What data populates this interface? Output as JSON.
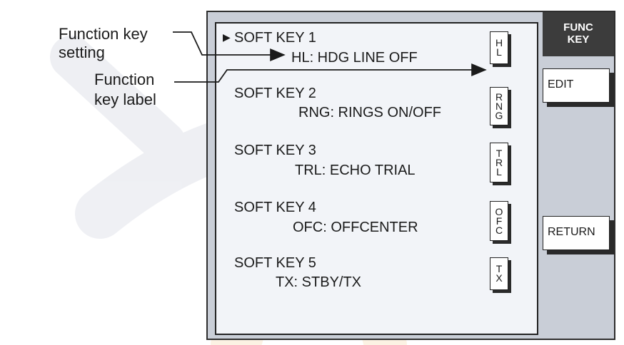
{
  "panel": {
    "title": "FUNC KEY"
  },
  "soft_keys": [
    {
      "title": "SOFT KEY 1",
      "setting": "HL: HDG LINE OFF",
      "label_chars": [
        "H",
        "L"
      ]
    },
    {
      "title": "SOFT KEY 2",
      "setting": "RNG: RINGS ON/OFF",
      "label_chars": [
        "R",
        "N",
        "G"
      ]
    },
    {
      "title": "SOFT KEY 3",
      "setting": "TRL: ECHO TRIAL",
      "label_chars": [
        "T",
        "R",
        "L"
      ]
    },
    {
      "title": "SOFT KEY 4",
      "setting": "OFC: OFFCENTER",
      "label_chars": [
        "O",
        "F",
        "C"
      ]
    },
    {
      "title": "SOFT KEY 5",
      "setting": "TX: STBY/TX",
      "label_chars": [
        "T",
        "X"
      ]
    }
  ],
  "cursor": "▶",
  "buttons": {
    "edit": "EDIT",
    "return": "RETURN"
  },
  "annotations": {
    "function_key_setting_line1": "Function key",
    "function_key_setting_line2": "setting",
    "function_key_label_line1": "Function",
    "function_key_label_line2": "key label"
  },
  "colors": {
    "screen_bg": "#c9ced7",
    "panel_bg": "#f2f4f8",
    "header_bg": "#3c3c3c"
  }
}
